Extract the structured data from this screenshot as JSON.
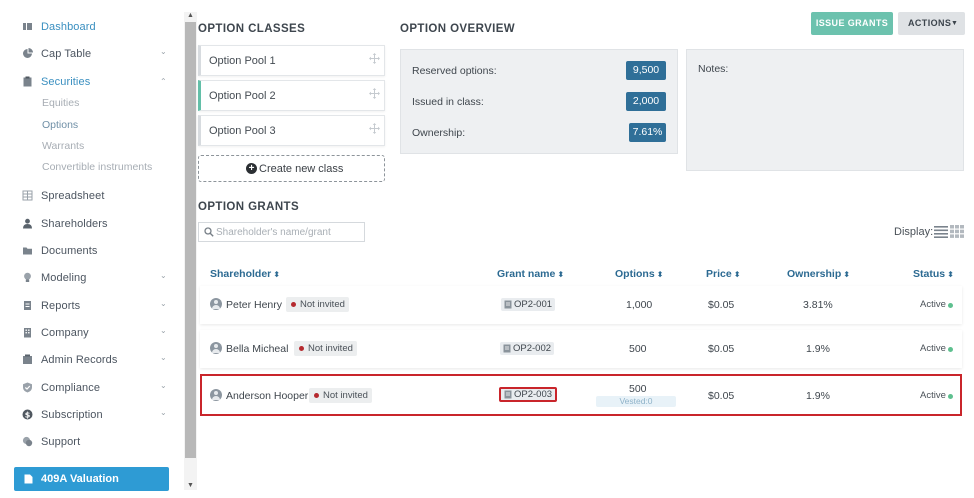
{
  "sidebar": {
    "items": [
      {
        "label": "Dashboard",
        "icon": "dashboard-icon"
      },
      {
        "label": "Cap Table",
        "icon": "pie-chart-icon"
      },
      {
        "label": "Securities",
        "icon": "clipboard-icon"
      },
      {
        "label": "Spreadsheet",
        "icon": "spreadsheet-icon"
      },
      {
        "label": "Shareholders",
        "icon": "user-icon"
      },
      {
        "label": "Documents",
        "icon": "folder-icon"
      },
      {
        "label": "Modeling",
        "icon": "lightbulb-icon"
      },
      {
        "label": "Reports",
        "icon": "reports-icon"
      },
      {
        "label": "Company",
        "icon": "building-icon"
      },
      {
        "label": "Admin Records",
        "icon": "admin-records-icon"
      },
      {
        "label": "Compliance",
        "icon": "shield-check-icon"
      },
      {
        "label": "Subscription",
        "icon": "dollar-icon"
      },
      {
        "label": "Support",
        "icon": "support-icon"
      }
    ],
    "securities_sub": [
      "Equities",
      "Options",
      "Warrants",
      "Convertible instruments"
    ],
    "valuation_label": "409A Valuation"
  },
  "option_classes": {
    "title": "OPTION CLASSES",
    "classes": [
      "Option Pool 1",
      "Option Pool 2",
      "Option Pool 3"
    ],
    "selected_index": 1,
    "create_label": "Create new class"
  },
  "overview": {
    "title": "OPTION OVERVIEW",
    "reserved_label": "Reserved options:",
    "reserved_value": "9,500",
    "issued_label": "Issued in class:",
    "issued_value": "2,000",
    "ownership_label": "Ownership:",
    "ownership_value": "7.61%",
    "notes_label": "Notes:"
  },
  "toolbar": {
    "issue_label": "ISSUE GRANTS",
    "actions_label": "ACTIONS"
  },
  "grants": {
    "title": "OPTION GRANTS",
    "search_placeholder": "Shareholder's name/grant",
    "display_label": "Display:",
    "columns": {
      "shareholder": "Shareholder",
      "grant_name": "Grant name",
      "options": "Options",
      "price": "Price",
      "ownership": "Ownership",
      "status": "Status"
    },
    "rows": [
      {
        "shareholder": "Peter Henry",
        "invite": "Not invited",
        "grant": "OP2-001",
        "options": "1,000",
        "vested": "",
        "price": "$0.05",
        "ownership": "3.81%",
        "status": "Active"
      },
      {
        "shareholder": "Bella Micheal",
        "invite": "Not invited",
        "grant": "OP2-002",
        "options": "500",
        "vested": "",
        "price": "$0.05",
        "ownership": "1.9%",
        "status": "Active"
      },
      {
        "shareholder": "Anderson Hooper",
        "invite": "Not invited",
        "grant": "OP2-003",
        "options": "500",
        "vested": "Vested:0",
        "price": "$0.05",
        "ownership": "1.9%",
        "status": "Active"
      }
    ]
  },
  "colors": {
    "accent_blue": "#2e9bd4",
    "value_blue": "#2f6f98",
    "issue_green": "#6cc2ae",
    "status_green": "#5ec08f",
    "not_invited_red": "#b52a2f",
    "highlight_red": "#c9252b"
  }
}
